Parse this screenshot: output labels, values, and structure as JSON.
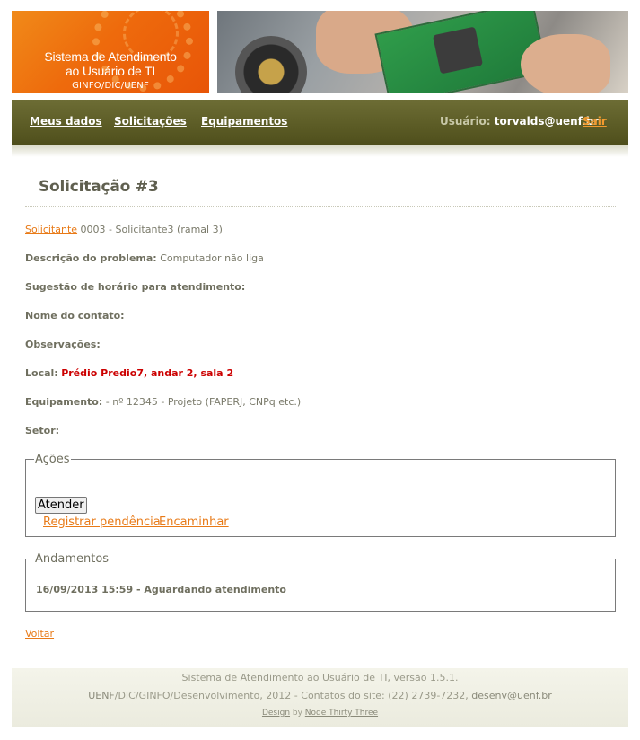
{
  "header": {
    "logo_line1": "Sistema de Atendimento",
    "logo_line2": "ao Usuário de TI",
    "logo_sub": "GINFO/DIC/UENF"
  },
  "menu": {
    "items": [
      {
        "label": "Meus dados"
      },
      {
        "label": "Solicitações"
      },
      {
        "label": "Equipamentos"
      }
    ],
    "user_label": "Usuário:",
    "user_value": "torvalds@uenf.br",
    "logout": "Sair"
  },
  "request": {
    "title": "Solicitação #3",
    "requester_link": "Solicitante",
    "requester_value": "0003 - Solicitante3 (ramal 3)",
    "problem_label": "Descrição do problema:",
    "problem_value": "Computador não liga",
    "schedule_label": "Sugestão de horário para atendimento:",
    "schedule_value": "",
    "contact_label": "Nome do contato:",
    "contact_value": "",
    "notes_label": "Observações:",
    "notes_value": "",
    "location_label": "Local:",
    "location_value": "Prédio Predio7, andar 2, sala 2",
    "equipment_label": "Equipamento:",
    "equipment_value": "- nº 12345 - Projeto (FAPERJ, CNPq etc.)",
    "sector_label": "Setor:",
    "sector_value": ""
  },
  "actions": {
    "legend": "Ações",
    "primary_button": "Atender",
    "link_pending": "Registrar pendência",
    "link_forward": "Encaminhar"
  },
  "history": {
    "legend": "Andamentos",
    "items": [
      {
        "text": "16/09/2013 15:59 - Aguardando atendimento"
      }
    ]
  },
  "back_link": "Voltar",
  "footer": {
    "line1": "Sistema de Atendimento ao Usuário de TI, versão 1.5.1.",
    "org_link": "UENF",
    "line2_mid": "/DIC/GINFO/Desenvolvimento, 2012 - Contatos do site: (22) 2739-7232, ",
    "email_link": "desenv@uenf.br",
    "design_link": "Design",
    "by_text": " by ",
    "author_link": "Node Thirty Three"
  }
}
